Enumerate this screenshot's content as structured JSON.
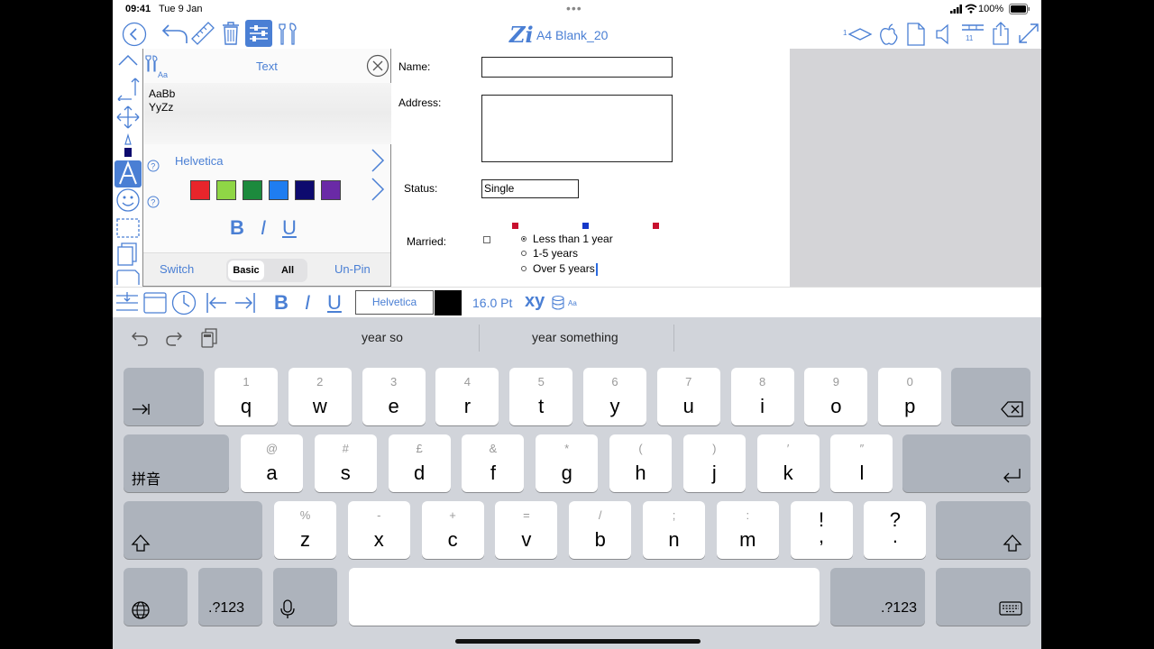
{
  "status_bar": {
    "time": "09:41",
    "date": "Tue 9 Jan",
    "battery": "100%"
  },
  "toolbar": {
    "title": "A4 Blank_20",
    "logo": "Zi",
    "page_indicator": "1",
    "layer_number": "11",
    "icons": [
      "back-icon",
      "undo-icon",
      "ruler-icon",
      "trash-icon",
      "settings-sliders-icon",
      "tools-icon",
      "page-navigation-icon",
      "apple-icon",
      "document-icon",
      "speaker-icon",
      "layers-icon",
      "share-icon",
      "expand-icon"
    ]
  },
  "form": {
    "name_label": "Name:",
    "address_label": "Address:",
    "status_label": "Status:",
    "status_value": "Single",
    "married_label": "Married:",
    "options": [
      {
        "label": "Less than 1 year",
        "selected": true
      },
      {
        "label": "1-5 years",
        "selected": false
      },
      {
        "label": "Over 5 years",
        "selected": false
      }
    ]
  },
  "text_panel": {
    "title": "Text",
    "preview_line1": "AaBb",
    "preview_line2": "YyZz",
    "font": "Helvetica",
    "colors": [
      "#e8252b",
      "#8fd646",
      "#1c8a3d",
      "#1f7df0",
      "#0d0a6e",
      "#6a2aa6"
    ],
    "bold": "B",
    "italic": "I",
    "underline": "U",
    "switch_label": "Switch",
    "seg_basic": "Basic",
    "seg_all": "All",
    "unpin_label": "Un-Pin"
  },
  "format_bar": {
    "bold": "B",
    "italic": "I",
    "underline": "U",
    "font": "Helvetica",
    "color": "#000000",
    "size": "16.0 Pt",
    "xy": "xy",
    "aa": "Aa"
  },
  "keyboard": {
    "suggestions": [
      "year so",
      "year something"
    ],
    "row1": [
      {
        "hint": "1",
        "key": "q"
      },
      {
        "hint": "2",
        "key": "w"
      },
      {
        "hint": "3",
        "key": "e"
      },
      {
        "hint": "4",
        "key": "r"
      },
      {
        "hint": "5",
        "key": "t"
      },
      {
        "hint": "6",
        "key": "y"
      },
      {
        "hint": "7",
        "key": "u"
      },
      {
        "hint": "8",
        "key": "i"
      },
      {
        "hint": "9",
        "key": "o"
      },
      {
        "hint": "0",
        "key": "p"
      }
    ],
    "row2": [
      {
        "hint": "@",
        "key": "a"
      },
      {
        "hint": "#",
        "key": "s"
      },
      {
        "hint": "£",
        "key": "d"
      },
      {
        "hint": "&",
        "key": "f"
      },
      {
        "hint": "*",
        "key": "g"
      },
      {
        "hint": "(",
        "key": "h"
      },
      {
        "hint": ")",
        "key": "j"
      },
      {
        "hint": "′",
        "key": "k"
      },
      {
        "hint": "″",
        "key": "l"
      }
    ],
    "row3": [
      {
        "hint": "%",
        "key": "z"
      },
      {
        "hint": "-",
        "key": "x"
      },
      {
        "hint": "+",
        "key": "c"
      },
      {
        "hint": "=",
        "key": "v"
      },
      {
        "hint": "/",
        "key": "b"
      },
      {
        "hint": ";",
        "key": "n"
      },
      {
        "hint": ":",
        "key": "m"
      },
      {
        "hint": "!",
        "key": ","
      },
      {
        "hint": "?",
        "key": "."
      }
    ],
    "pinyin": "拼音",
    "numbers": ".?123"
  }
}
